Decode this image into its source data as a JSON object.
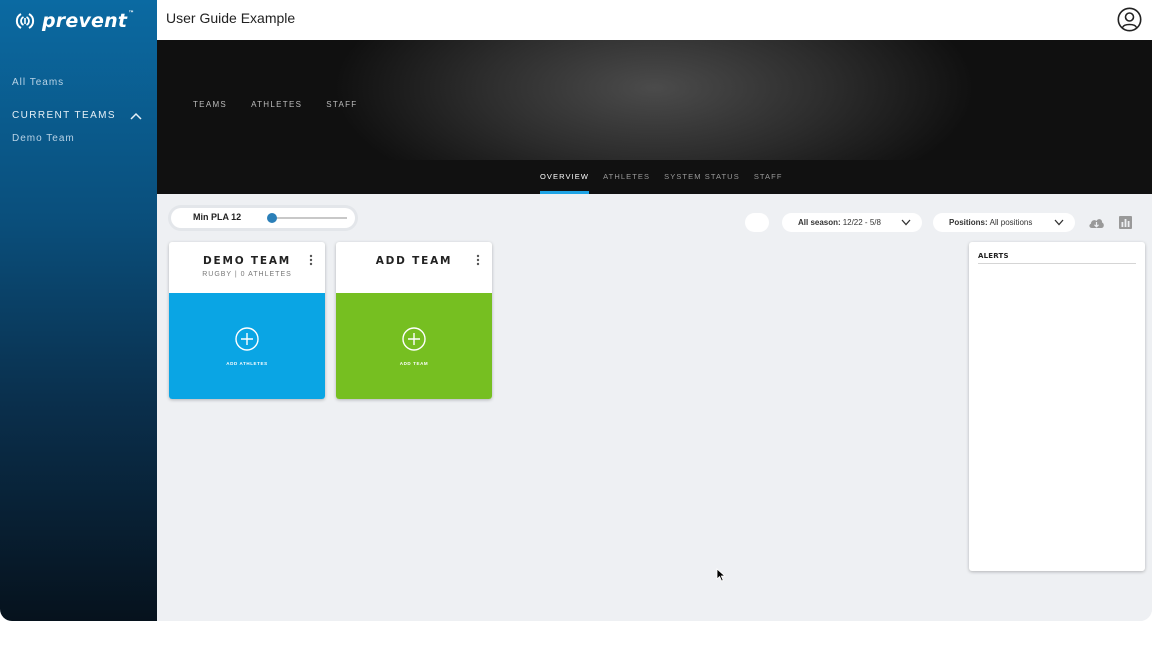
{
  "sidebar": {
    "logo_text": "prevent",
    "logo_tm": "™",
    "all_teams": "All Teams",
    "current_teams": "CURRENT TEAMS",
    "demo_team": "Demo Team"
  },
  "topbar": {
    "title": "User Guide Example"
  },
  "hero": {
    "nav": [
      "TEAMS",
      "ATHLETES",
      "STAFF"
    ]
  },
  "subnav": {
    "tabs": [
      "OVERVIEW",
      "ATHLETES",
      "SYSTEM STATUS",
      "STAFF"
    ],
    "active": "OVERVIEW"
  },
  "filters": {
    "pla_label": "Min PLA 12",
    "season_label": "All season:",
    "season_value": "12/22 - 5/8",
    "positions_label": "Positions:",
    "positions_value": "All positions"
  },
  "cards": {
    "demo": {
      "title": "DEMO TEAM",
      "subtitle": "RUGBY | 0 ATHLETES",
      "action": "ADD ATHLETES"
    },
    "add": {
      "title": "ADD TEAM",
      "action": "ADD TEAM"
    }
  },
  "alerts": {
    "title": "ALERTS"
  },
  "colors": {
    "accent_blue": "#1ea3e4",
    "card_blue": "#0aa5e4",
    "card_green": "#76bf21"
  },
  "icons": [
    "prevent-logo-icon",
    "chevron-up-icon",
    "user-icon",
    "chevron-down-icon",
    "cloud-download-icon",
    "bar-chart-icon",
    "kebab-menu-icon",
    "plus-circle-icon",
    "cursor-icon"
  ]
}
